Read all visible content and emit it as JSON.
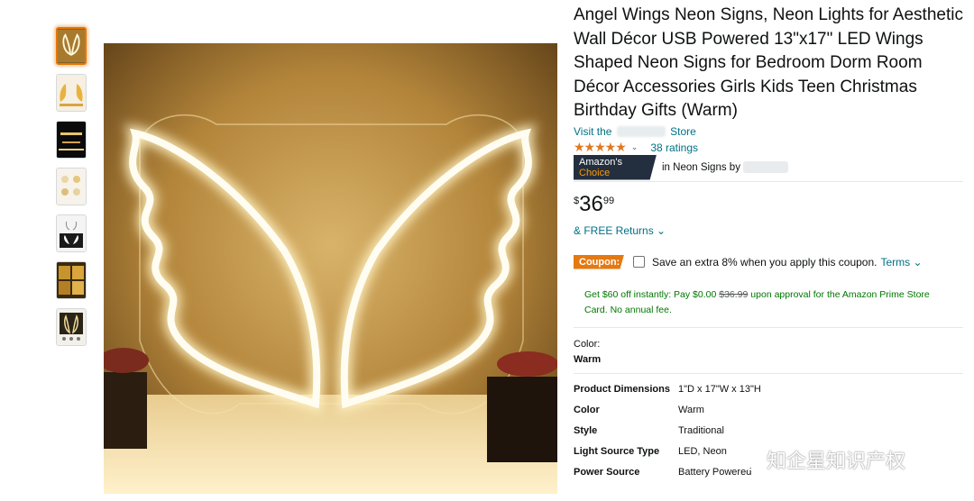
{
  "product": {
    "title": "Angel Wings Neon Signs, Neon Lights for Aesthetic Wall Décor USB Powered 13\"x17\" LED Wings Shaped Neon Signs for Bedroom Dorm Room Décor Accessories Girls Kids Teen Christmas Birthday Gifts (Warm)",
    "store_prefix": "Visit the",
    "store_suffix": "Store",
    "stars": "★★★★★",
    "ratings_label": "38 ratings",
    "badge_amazons": "Amazon's",
    "badge_choice": "Choice",
    "badge_suffix": "in Neon Signs by",
    "price_symbol": "$",
    "price_whole": "36",
    "price_fraction": "99",
    "returns": "& FREE Returns ⌄",
    "coupon_badge": "Coupon:",
    "coupon_text": "Save an extra 8% when you apply this coupon.",
    "coupon_terms": "Terms ⌄",
    "prime_before": "Get $60 off instantly: Pay $0.00",
    "prime_strike": "$36.99",
    "prime_after": "upon approval for the Amazon Prime Store Card. No annual fee.",
    "color_label": "Color:",
    "color_value": "Warm"
  },
  "specs": [
    {
      "key": "Product Dimensions",
      "value": "1\"D x 17\"W x 13\"H"
    },
    {
      "key": "Color",
      "value": "Warm"
    },
    {
      "key": "Style",
      "value": "Traditional"
    },
    {
      "key": "Light Source Type",
      "value": "LED, Neon"
    },
    {
      "key": "Power Source",
      "value": "Battery Powered"
    }
  ],
  "watermark": "知企星知识产权",
  "colors": {
    "star": "#de7921",
    "link": "#007185",
    "coupon": "#e47911",
    "prime": "#007600",
    "badge": "#232f3e"
  }
}
